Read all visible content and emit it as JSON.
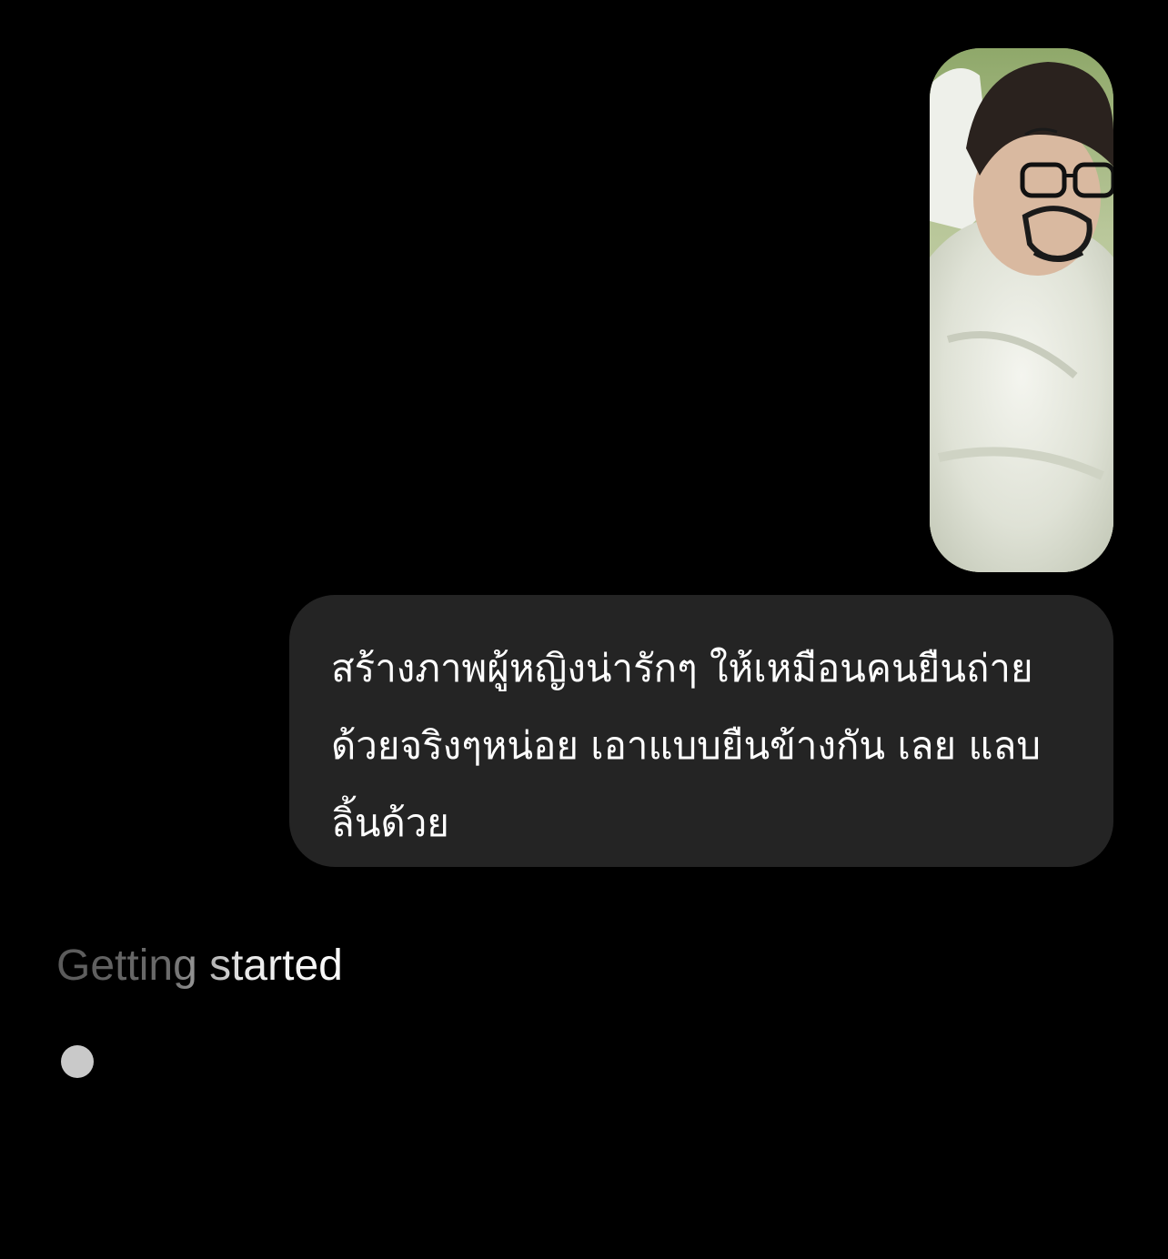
{
  "chat": {
    "user_photo": {
      "icon": "sent-photo-image"
    },
    "user_message": "สร้างภาพผู้หญิงน่ารักๆ ให้เหมือนคนยืนถ่ายด้วยจริงๆหน่อย เอาแบบยืนข้างกัน เลย แลบลิ้นด้วย"
  },
  "assistant": {
    "status_text": "Getting started",
    "typing_indicator": {
      "icon": "loading-dot-icon",
      "color": "#c9c9c9"
    }
  },
  "colors": {
    "background": "#000000",
    "user_bubble": "#242424",
    "text": "#ffffff",
    "status_dim": "#6a6a6a"
  }
}
